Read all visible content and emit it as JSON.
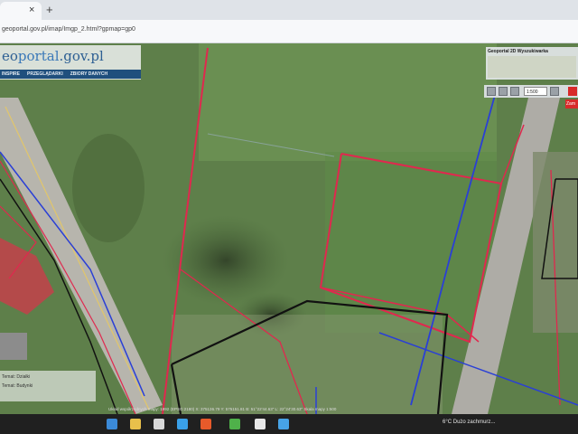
{
  "browser": {
    "tab_close": "×",
    "new_tab": "+",
    "url": "geoportal.gov.pl/imap/Imgp_2.html?gpmap=gp0"
  },
  "geoportal": {
    "logo_prefix": "eo",
    "logo_main": "portal",
    "logo_suffix": ".gov.pl",
    "nav_items": [
      "INSPIRE",
      "PRZEGLĄDARKI",
      "ZBIORY DANYCH"
    ],
    "overview_title": "Geoportal 2D Wyszukiwarka",
    "scale_value": "1:500"
  },
  "map": {
    "tag_label": "Zam",
    "legend_rows": [
      "Temat: Działki",
      "Temat: Budynki"
    ],
    "status_text": "Układ współrzędnych mapy: 1992 (EPSG:2180)   X: 375136.79  Y: 575151.81   B: 51°22'44.63\"  L: 22°24'30.63\"   Skala mapy 1:500"
  },
  "taskbar": {
    "weather": "6°C  Dużo zachmurz..."
  },
  "colors": {
    "parcel_red": "#e0284e",
    "utility_blue": "#2a3fd6",
    "building_black": "#111111",
    "road": "#bdbdbd"
  }
}
